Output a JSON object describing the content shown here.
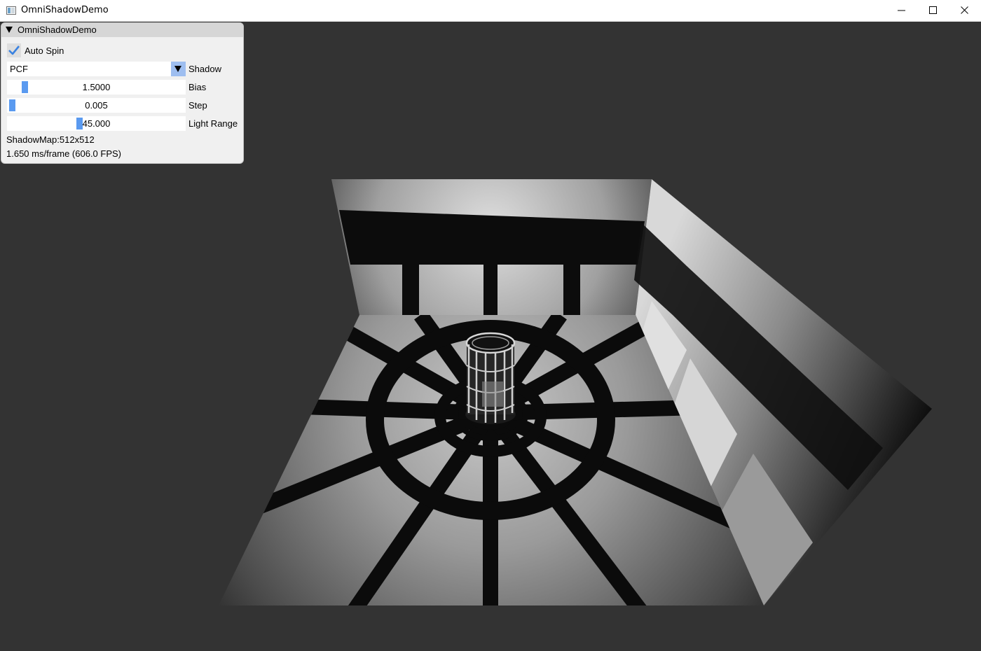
{
  "window": {
    "title": "OmniShadowDemo"
  },
  "panel": {
    "title": "OmniShadowDemo",
    "auto_spin": {
      "label": "Auto Spin",
      "checked": true
    },
    "shadow": {
      "value": "PCF",
      "label": "Shadow"
    },
    "bias": {
      "value": "1.5000",
      "label": "Bias"
    },
    "step": {
      "value": "0.005",
      "label": "Step"
    },
    "light_range": {
      "value": "45.000",
      "label": "Light Range"
    },
    "shadowmap_text": "ShadowMap:512x512",
    "fps_text": "1.650 ms/frame (606.0 FPS)"
  },
  "colors": {
    "background": "#333333",
    "panel_bg": "#f0f0f0",
    "accent": "#5a9af0",
    "checkmark": "#3a82e0"
  }
}
